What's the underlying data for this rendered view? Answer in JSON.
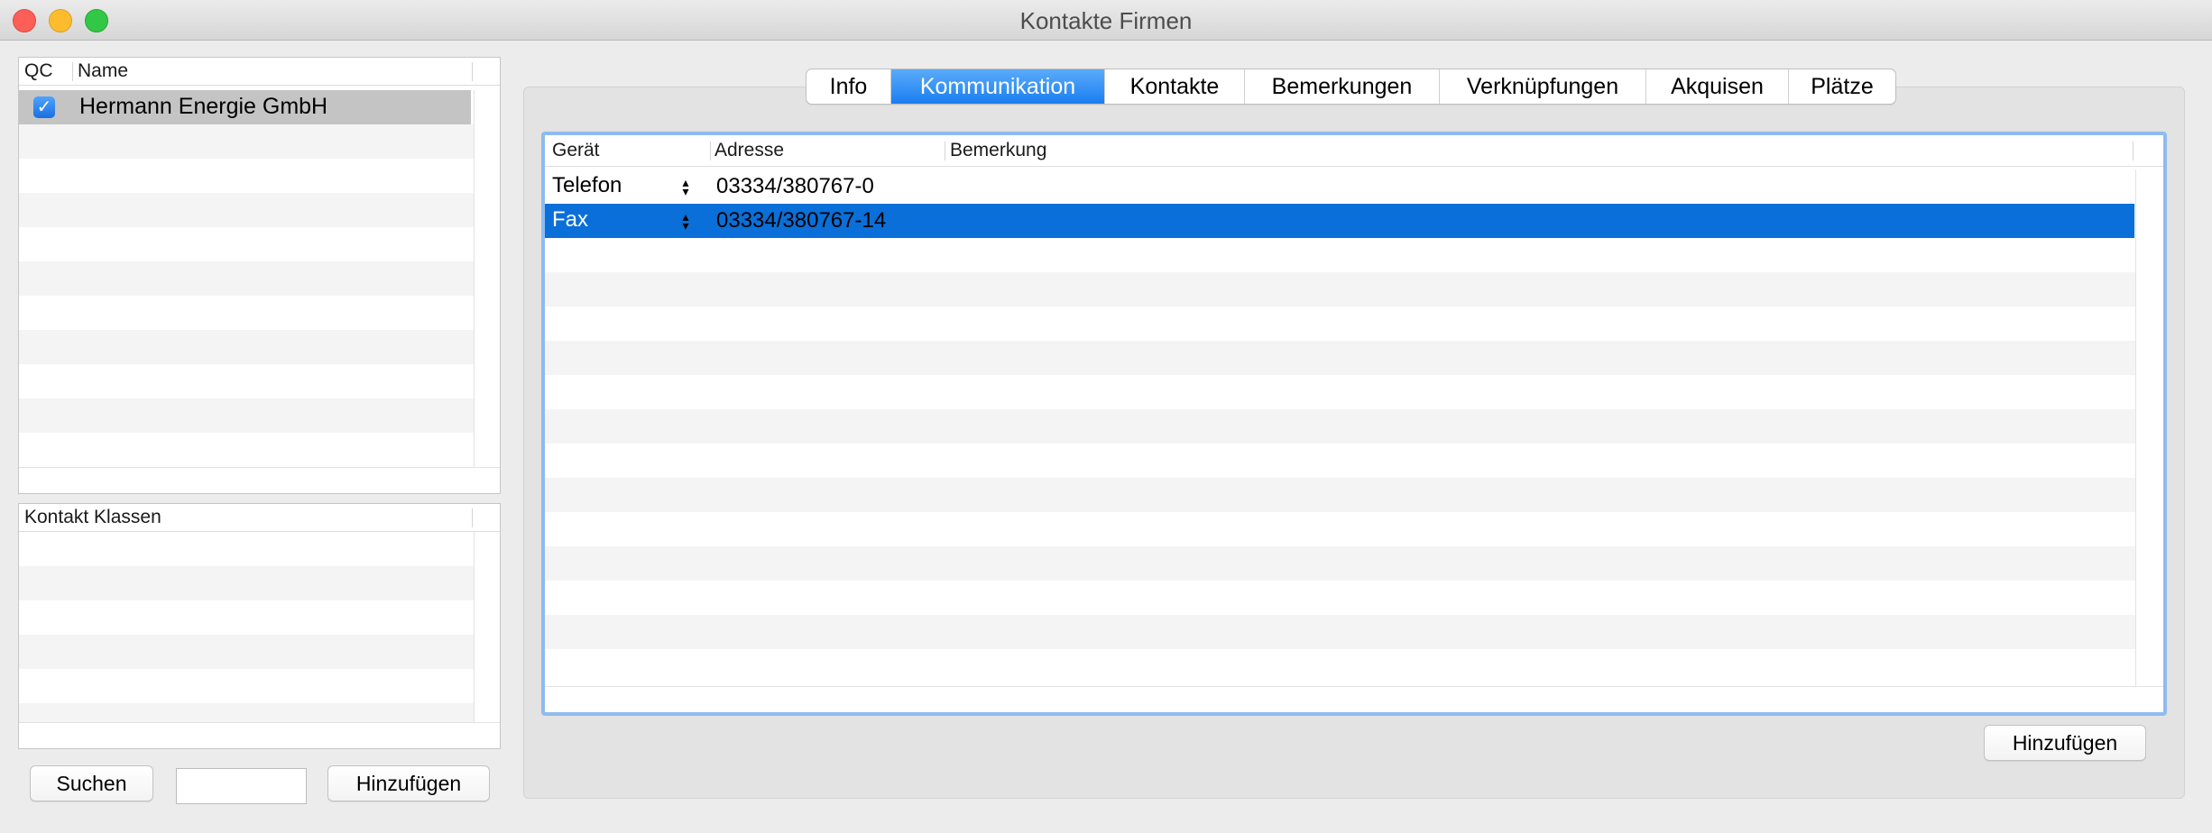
{
  "window": {
    "title": "Kontakte Firmen"
  },
  "companies": {
    "columns": [
      "QC",
      "Name"
    ],
    "rows": [
      {
        "qc_checked": true,
        "name": "Hermann Energie GmbH"
      }
    ]
  },
  "classes": {
    "columns": [
      "Kontakt Klassen"
    ]
  },
  "left_buttons": {
    "search": "Suchen",
    "add": "Hinzufügen",
    "search_value": ""
  },
  "tabs": [
    {
      "label": "Info",
      "active": false
    },
    {
      "label": "Kommunikation",
      "active": true
    },
    {
      "label": "Kontakte",
      "active": false
    },
    {
      "label": "Bemerkungen",
      "active": false
    },
    {
      "label": "Verknüpfungen",
      "active": false
    },
    {
      "label": "Akquisen",
      "active": false
    },
    {
      "label": "Plätze",
      "active": false
    }
  ],
  "communication": {
    "columns": [
      "Gerät",
      "Adresse",
      "Bemerkung"
    ],
    "rows": [
      {
        "device": "Telefon",
        "address": "03334/380767-0",
        "note": "",
        "selected": false
      },
      {
        "device": "Fax",
        "address": "03334/380767-14",
        "note": "",
        "selected": true
      }
    ],
    "add_button": "Hinzufügen"
  },
  "colors": {
    "selection_blue": "#0a6fd8",
    "focus_ring": "#8fbbf0",
    "row_grey": "#c4c4c4"
  }
}
